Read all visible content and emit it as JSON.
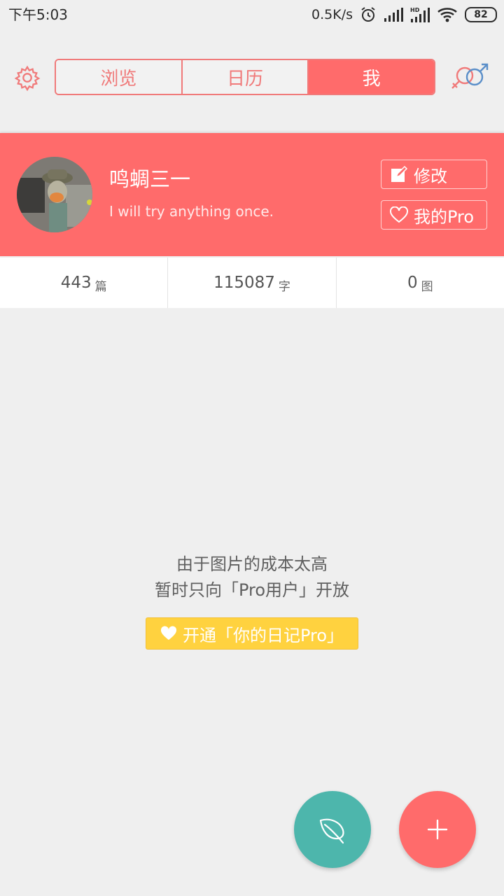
{
  "status_bar": {
    "time": "下午5:03",
    "net_speed": "0.5K/s",
    "battery": "82"
  },
  "nav": {
    "tabs": [
      {
        "label": "浏览",
        "active": false
      },
      {
        "label": "日历",
        "active": false
      },
      {
        "label": "我",
        "active": true
      }
    ],
    "settings_icon": "gear-icon",
    "gender_icon": "gender-icon"
  },
  "profile": {
    "name": "鸣蜩三一",
    "motto": "I will try anything once.",
    "edit_label": "修改",
    "pro_label": "我的Pro"
  },
  "stats": [
    {
      "value": "443",
      "unit": "篇"
    },
    {
      "value": "115087",
      "unit": "字"
    },
    {
      "value": "0",
      "unit": "图"
    }
  ],
  "notice": {
    "line1": "由于图片的成本太高",
    "line2": "暂时只向「Pro用户」开放",
    "cta_label": "开通「你的日记Pro」"
  },
  "colors": {
    "accent": "#ff6b6b",
    "fab_teal": "#4db6ac",
    "cta_yellow": "#ffd23f"
  }
}
